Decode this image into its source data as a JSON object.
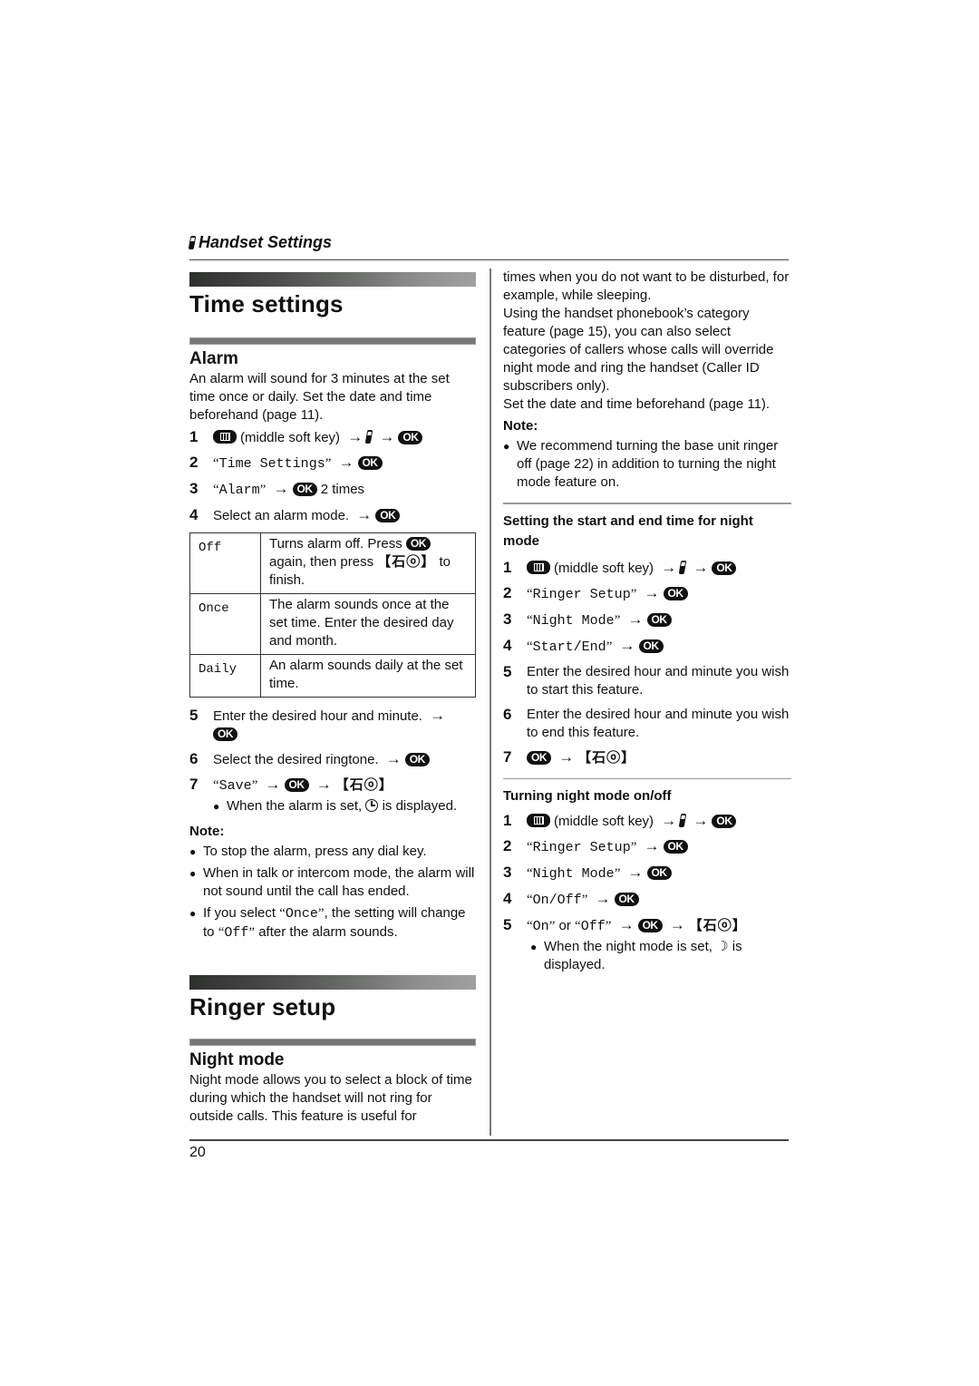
{
  "header": {
    "icon": "handset-icon",
    "title": "Handset Settings"
  },
  "time_settings": {
    "title": "Time settings",
    "alarm": {
      "title": "Alarm",
      "intro": "An alarm will sound for 3 minutes at the set time once or daily. Set the date and time beforehand (page 11).",
      "steps": [
        {
          "num": "1",
          "text_a": "(middle soft key)"
        },
        {
          "num": "2",
          "menu": "Time Settings"
        },
        {
          "num": "3",
          "menu": "Alarm",
          "suffix": "2 times"
        },
        {
          "num": "4",
          "text": "Select an alarm mode."
        }
      ],
      "modes_table": [
        {
          "mode": "Off",
          "desc_a": "Turns alarm off. Press",
          "desc_b": "again, then press",
          "desc_c": "to finish."
        },
        {
          "mode": "Once",
          "desc": "The alarm sounds once at the set time. Enter the desired day and month."
        },
        {
          "mode": "Daily",
          "desc": "An alarm sounds daily at the set time."
        }
      ],
      "steps_after": [
        {
          "num": "5",
          "text": "Enter the desired hour and minute."
        },
        {
          "num": "6",
          "text": "Select the desired ringtone."
        },
        {
          "num": "7",
          "menu": "Save"
        }
      ],
      "step7_bullet_a": "When the alarm is set,",
      "step7_bullet_b": "is displayed.",
      "note_label": "Note:",
      "notes": [
        "To stop the alarm, press any dial key.",
        "When in talk or intercom mode, the alarm will not sound until the call has ended."
      ],
      "note3": {
        "a": "If you select",
        "m1": "Once",
        "b": ", the setting will change to",
        "m2": "Off",
        "c": "after the alarm sounds."
      }
    }
  },
  "ringer_setup": {
    "title": "Ringer setup",
    "night_mode": {
      "title": "Night mode",
      "intro": "Night mode allows you to select a block of time during which the handset will not ring for outside calls. This feature is useful for",
      "intro_cont": "times when you do not want to be disturbed, for example, while sleeping.",
      "para2": "Using the handset phonebook’s category feature (page 15), you can also select categories of callers whose calls will override night mode and ring the handset (Caller ID subscribers only).",
      "para3": "Set the date and time beforehand (page 11).",
      "note_label": "Note:",
      "note": "We recommend turning the base unit ringer off (page 22) in addition to turning the night mode feature on.",
      "start_end": {
        "title": "Setting the start and end time for night mode",
        "steps": [
          {
            "num": "1",
            "text_a": "(middle soft key)"
          },
          {
            "num": "2",
            "menu": "Ringer Setup"
          },
          {
            "num": "3",
            "menu": "Night Mode"
          },
          {
            "num": "4",
            "menu": "Start/End"
          },
          {
            "num": "5",
            "text": "Enter the desired hour and minute you wish to start this feature."
          },
          {
            "num": "6",
            "text": "Enter the desired hour and minute you wish to end this feature."
          },
          {
            "num": "7"
          }
        ]
      },
      "on_off": {
        "title": "Turning night mode on/off",
        "steps": [
          {
            "num": "1",
            "text_a": "(middle soft key)"
          },
          {
            "num": "2",
            "menu": "Ringer Setup"
          },
          {
            "num": "3",
            "menu": "Night Mode"
          },
          {
            "num": "4",
            "menu": "On/Off"
          },
          {
            "num": "5",
            "menu_a": "On",
            "or": "or",
            "menu_b": "Off"
          }
        ],
        "bullet_a": "When the night mode is set,",
        "bullet_b": "is displayed."
      }
    }
  },
  "symbols": {
    "ok": "OK",
    "arrow": "→",
    "end_key": "【⽯ⓞ】",
    "bullet": "●",
    "open_q": "“",
    "close_q": "”"
  },
  "footer": {
    "page_number": "20"
  }
}
